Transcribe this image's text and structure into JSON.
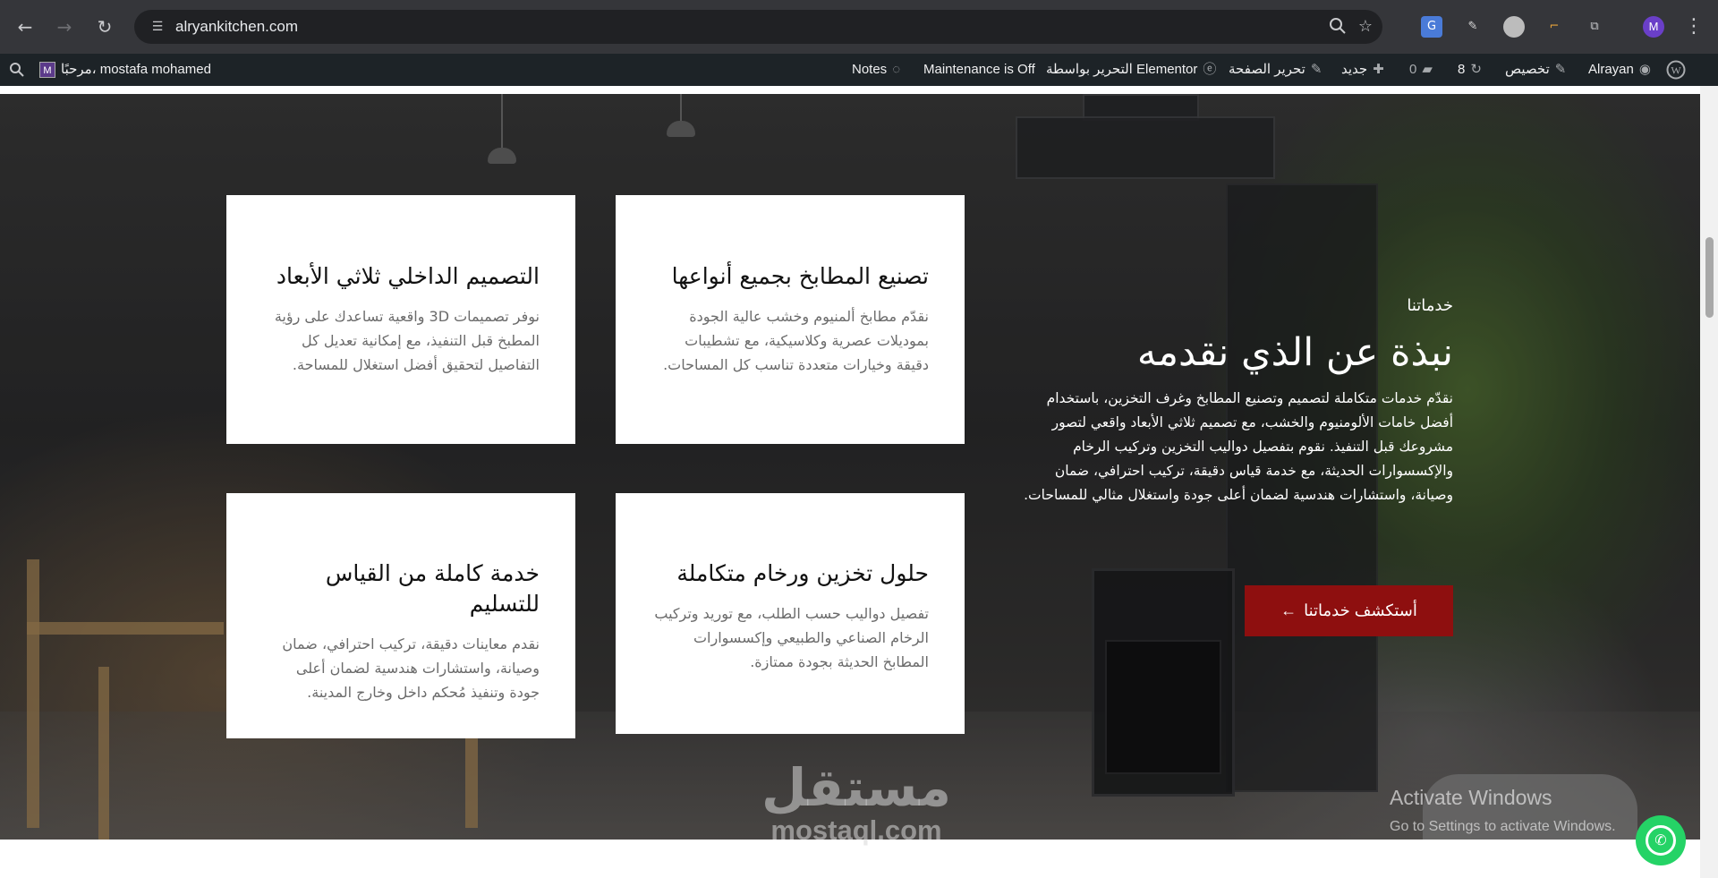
{
  "browser": {
    "url": "alryankitchen.com",
    "back_glyph": "←",
    "forward_glyph": "→",
    "reload_glyph": "↻",
    "profile_letter": "M",
    "menu_glyph": "⋮"
  },
  "admin_bar": {
    "site_name": "Alrayan",
    "customize": "تخصيص",
    "updates_count": "8",
    "comments_count": "0",
    "new": "جديد",
    "edit_page": "تحرير الصفحة",
    "elementor_edit": "التحرير بواسطة Elementor",
    "maintenance": "Maintenance is Off",
    "notes": "Notes",
    "greeting": "مرحبًا، mostafa mohamed",
    "avatar_letter": "M"
  },
  "services": {
    "kicker": "خدماتنا",
    "heading": "نبذة عن الذي نقدمه",
    "body": "نقدّم خدمات متكاملة لتصميم وتصنيع المطابخ وغرف التخزين، باستخدام أفضل خامات الألومنيوم والخشب، مع تصميم ثلاثي الأبعاد واقعي لتصور مشروعك قبل التنفيذ. نقوم بتفصيل دواليب التخزين وتركيب الرخام والإكسسوارات الحديثة، مع خدمة قياس دقيقة، تركيب احترافي، ضمان وصيانة، واستشارات هندسية لضمان أعلى جودة واستغلال مثالي للمساحات.",
    "cta_label": "أستكشف خدماتنا",
    "cta_arrow": "➜",
    "cards": [
      {
        "title": "تصنيع المطابخ بجميع أنواعها",
        "text": "نقدّم مطابخ ألمنيوم وخشب عالية الجودة بموديلات عصرية وكلاسيكية، مع تشطيبات دقيقة وخيارات متعددة تناسب كل المساحات."
      },
      {
        "title": "التصميم الداخلي ثلاثي الأبعاد",
        "text": "نوفر تصميمات 3D واقعية تساعدك على رؤية المطبخ قبل التنفيذ، مع إمكانية تعديل كل التفاصيل لتحقيق أفضل استغلال للمساحة."
      },
      {
        "title": "حلول تخزين ورخام متكاملة",
        "text": "تفصيل دواليب حسب الطلب، مع توريد وتركيب الرخام الصناعي والطبيعي وإكسسوارات المطابخ الحديثة بجودة ممتازة."
      },
      {
        "title": "خدمة كاملة من القياس للتسليم",
        "text": "نقدم معاينات دقيقة، تركيب احترافي، ضمان وصيانة، واستشارات هندسية لضمان أعلى جودة وتنفيذ مُحكم داخل وخارج المدينة."
      }
    ]
  },
  "overlays": {
    "windows_title": "Activate Windows",
    "windows_sub": "Go to Settings to activate Windows.",
    "watermark_ar": "مستقل",
    "watermark_en": "mostaql.com"
  },
  "colors": {
    "cta_bg": "#8e0f0f",
    "admin_bar_bg": "#1d2327",
    "browser_bg": "#35363a",
    "whatsapp": "#25d366"
  }
}
